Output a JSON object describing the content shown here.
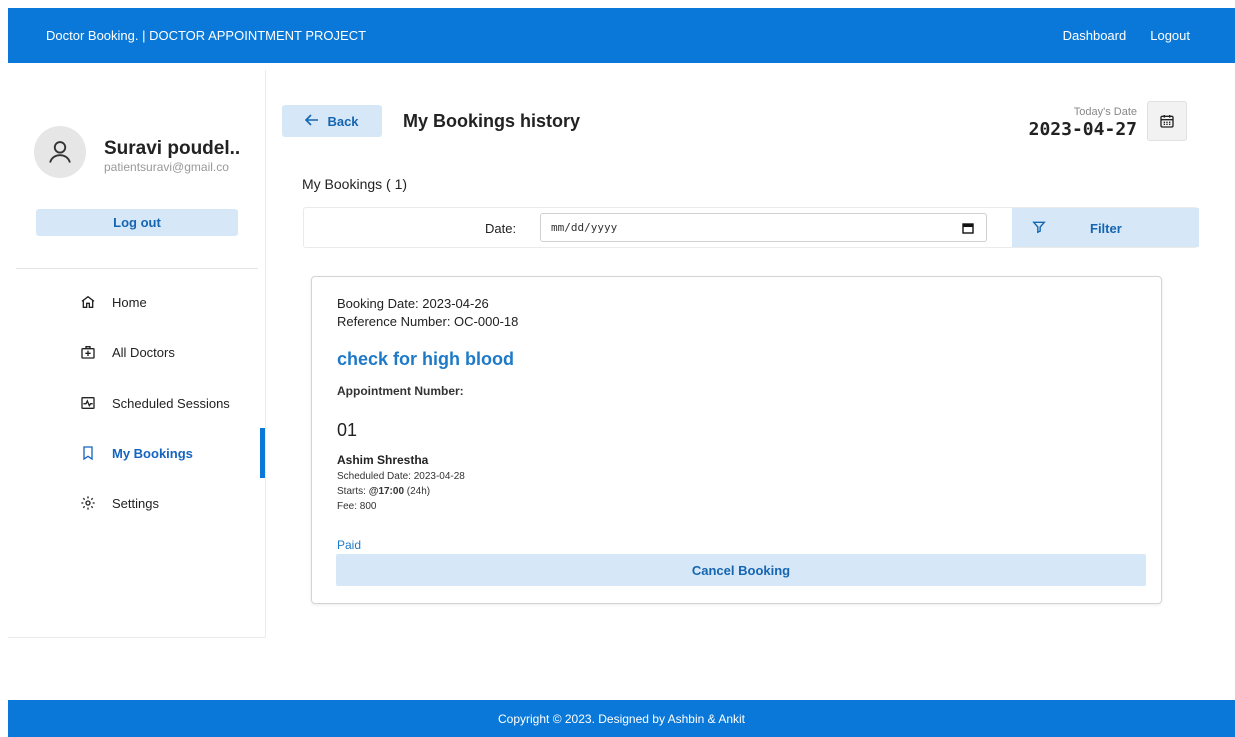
{
  "header": {
    "brand": "Doctor Booking. | DOCTOR APPOINTMENT PROJECT",
    "nav": {
      "dashboard": "Dashboard",
      "logout": "Logout"
    }
  },
  "sidebar": {
    "user": {
      "name": "Suravi poudel..",
      "email": "patientsuravi@gmail.co"
    },
    "logout_label": "Log out",
    "items": [
      {
        "label": "Home",
        "icon": "home-icon"
      },
      {
        "label": "All Doctors",
        "icon": "medical-kit-icon"
      },
      {
        "label": "Scheduled Sessions",
        "icon": "pulse-icon"
      },
      {
        "label": "My Bookings",
        "icon": "bookmark-icon",
        "active": true
      },
      {
        "label": "Settings",
        "icon": "gear-icon"
      }
    ]
  },
  "main": {
    "back_label": "Back",
    "title": "My Bookings history",
    "today_label": "Today's Date",
    "today_value": "2023-04-27",
    "count_heading": "My Bookings ( 1)",
    "filter": {
      "date_label": "Date:",
      "date_placeholder": "mm/dd/yyyy",
      "button_label": "Filter"
    },
    "bookings": [
      {
        "booking_date": "Booking Date: 2023-04-26",
        "reference": "Reference Number: OC-000-18",
        "title": "check for high blood",
        "appointment_label": "Appointment Number:",
        "appointment_number": "01",
        "doctor": "Ashim Shrestha",
        "scheduled_date": "Scheduled Date: 2023-04-28",
        "starts_prefix": "Starts: ",
        "starts_time": "@17:00",
        "starts_suffix": " (24h)",
        "fee": "Fee: 800",
        "status": "Paid",
        "cancel_label": "Cancel Booking"
      }
    ]
  },
  "footer": {
    "text": "Copyright © 2023. Designed by Ashbin & Ankit"
  },
  "colors": {
    "primary": "#0a78d8",
    "accent_light": "#d6e8f8",
    "link": "#1e7ac8"
  }
}
